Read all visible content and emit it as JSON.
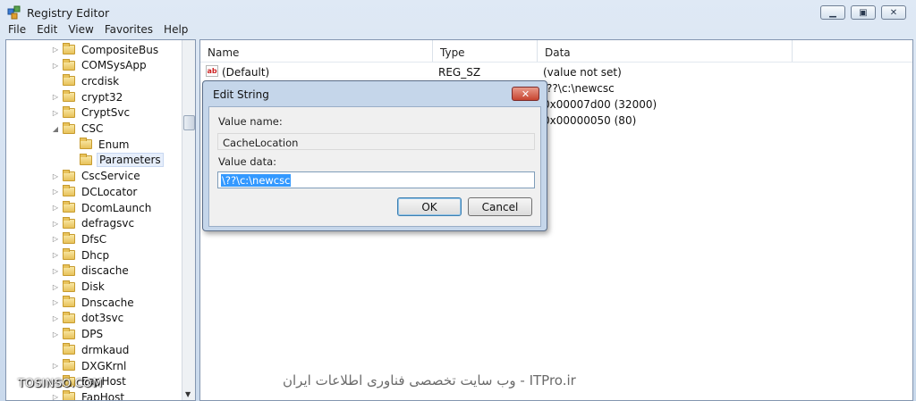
{
  "window": {
    "title": "Registry Editor",
    "minimize_glyph": "▁",
    "maximize_glyph": "▣",
    "close_glyph": "✕"
  },
  "menu": [
    "File",
    "Edit",
    "View",
    "Favorites",
    "Help"
  ],
  "tree": {
    "items": [
      {
        "label": "CompositeBus",
        "expander": "▷",
        "level": 0
      },
      {
        "label": "COMSysApp",
        "expander": "▷",
        "level": 0
      },
      {
        "label": "crcdisk",
        "expander": "",
        "level": 0
      },
      {
        "label": "crypt32",
        "expander": "▷",
        "level": 0
      },
      {
        "label": "CryptSvc",
        "expander": "▷",
        "level": 0
      },
      {
        "label": "CSC",
        "expander": "◢",
        "level": 0
      },
      {
        "label": "Enum",
        "expander": "",
        "level": 1
      },
      {
        "label": "Parameters",
        "expander": "",
        "level": 1,
        "selected": true
      },
      {
        "label": "CscService",
        "expander": "▷",
        "level": 0
      },
      {
        "label": "DCLocator",
        "expander": "▷",
        "level": 0
      },
      {
        "label": "DcomLaunch",
        "expander": "▷",
        "level": 0
      },
      {
        "label": "defragsvc",
        "expander": "▷",
        "level": 0
      },
      {
        "label": "DfsC",
        "expander": "▷",
        "level": 0
      },
      {
        "label": "Dhcp",
        "expander": "▷",
        "level": 0
      },
      {
        "label": "discache",
        "expander": "▷",
        "level": 0
      },
      {
        "label": "Disk",
        "expander": "▷",
        "level": 0
      },
      {
        "label": "Dnscache",
        "expander": "▷",
        "level": 0
      },
      {
        "label": "dot3svc",
        "expander": "▷",
        "level": 0
      },
      {
        "label": "DPS",
        "expander": "▷",
        "level": 0
      },
      {
        "label": "drmkaud",
        "expander": "",
        "level": 0
      },
      {
        "label": "DXGKrnl",
        "expander": "▷",
        "level": 0
      },
      {
        "label": "EapHost",
        "expander": "▷",
        "level": 0
      },
      {
        "label": "FapHost",
        "expander": "▷",
        "level": 0
      }
    ]
  },
  "values": {
    "headers": [
      "Name",
      "Type",
      "Data"
    ],
    "rows": [
      {
        "name": "(Default)",
        "type": "REG_SZ",
        "data": "(value not set)"
      },
      {
        "name": "",
        "type": "",
        "data": "\\??\\c:\\newcsc"
      },
      {
        "name": "",
        "type": "",
        "data": "0x00007d00 (32000)"
      },
      {
        "name": "",
        "type": "",
        "data": "0x00000050 (80)"
      }
    ]
  },
  "dialog": {
    "title": "Edit String",
    "close_glyph": "✕",
    "value_name_label": "Value name:",
    "value_name": "CacheLocation",
    "value_data_label": "Value data:",
    "value_data": "\\??\\c:\\newcsc",
    "ok_label": "OK",
    "cancel_label": "Cancel"
  },
  "watermarks": {
    "left": "TOSINSO.COM",
    "right": "ITPro.ir - وب سایت تخصصی فناوری اطلاعات ایران"
  }
}
